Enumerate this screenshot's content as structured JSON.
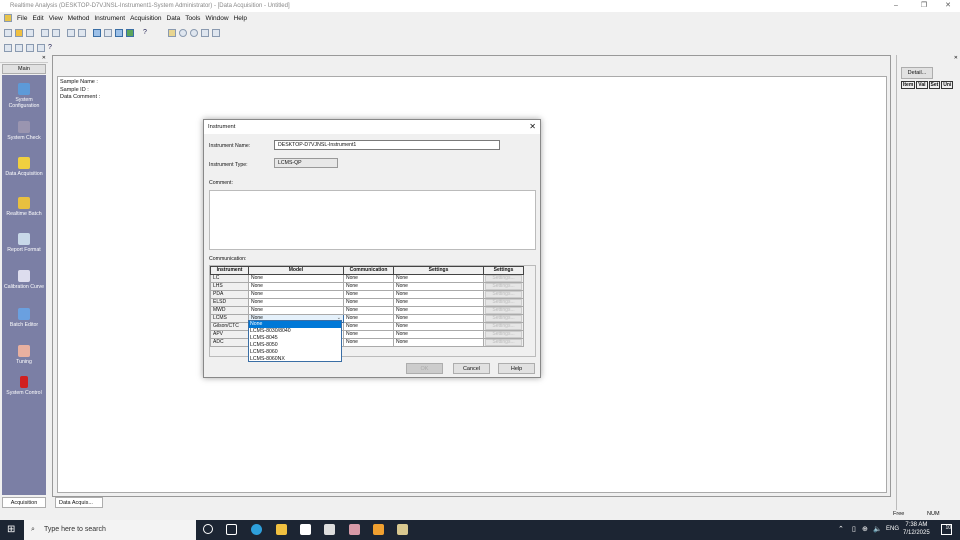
{
  "window": {
    "title": "Realtime Analysis (DESKTOP-D7VJNSL-Instrument1-System Administrator) - [Data Acquisition - Untitled]"
  },
  "menu": [
    "File",
    "Edit",
    "View",
    "Method",
    "Instrument",
    "Acquisition",
    "Data",
    "Tools",
    "Window",
    "Help"
  ],
  "leftpane": {
    "main_label": "Main",
    "bottom_tab": "Acquisition",
    "items": [
      {
        "label": "System Configuration",
        "icon": "system-configuration-icon"
      },
      {
        "label": "System Check",
        "icon": "system-check-icon"
      },
      {
        "label": "Data Acquisition",
        "icon": "data-acquisition-icon"
      },
      {
        "label": "Realtime Batch",
        "icon": "realtime-batch-icon"
      },
      {
        "label": "Report Format",
        "icon": "report-format-icon"
      },
      {
        "label": "Calibration Curve",
        "icon": "calibration-curve-icon"
      },
      {
        "label": "Batch Editor",
        "icon": "batch-editor-icon"
      },
      {
        "label": "Tuning",
        "icon": "tuning-icon"
      },
      {
        "label": "System Control",
        "icon": "system-control-icon"
      }
    ]
  },
  "main": {
    "sample_name": "Sample Name :",
    "sample_id": "Sample ID :",
    "data_comment": "Data Comment :",
    "tab": "Data Acquis..."
  },
  "rightpane": {
    "detail_button": "Detail...",
    "columns": [
      "Item",
      "Val",
      "Set",
      "Uni"
    ]
  },
  "status": {
    "free": "Free",
    "num": "NUM"
  },
  "dialog": {
    "title": "Instrument",
    "name_label": "Instrument Name:",
    "name_value": "DESKTOP-D7VJNSL-Instrument1",
    "type_label": "Instrument Type:",
    "type_value": "LCMS-QP",
    "comment_label": "Comment:",
    "comment_value": "",
    "communication_label": "Communication:",
    "columns": [
      "Instrument",
      "Model",
      "Communication",
      "Settings",
      "Settings"
    ],
    "rows": [
      {
        "instrument": "LC",
        "model": "None",
        "comm": "None",
        "settings": "None",
        "button": "Settings..."
      },
      {
        "instrument": "LHS",
        "model": "None",
        "comm": "None",
        "settings": "None",
        "button": "Settings..."
      },
      {
        "instrument": "PDA",
        "model": "None",
        "comm": "None",
        "settings": "None",
        "button": "Settings..."
      },
      {
        "instrument": "ELSD",
        "model": "None",
        "comm": "None",
        "settings": "None",
        "button": "Settings..."
      },
      {
        "instrument": "MWD",
        "model": "None",
        "comm": "None",
        "settings": "None",
        "button": "Settings..."
      },
      {
        "instrument": "LCMS",
        "model": "None",
        "comm": "None",
        "settings": "None",
        "button": "Settings..."
      },
      {
        "instrument": "Gilson/CTC",
        "model": "",
        "comm": "None",
        "settings": "None",
        "button": "Settings..."
      },
      {
        "instrument": "APV",
        "model": "",
        "comm": "None",
        "settings": "None",
        "button": "Settings..."
      },
      {
        "instrument": "ADC",
        "model": "",
        "comm": "None",
        "settings": "None",
        "button": "Settings..."
      }
    ],
    "dropdown_options": [
      "None",
      "LCMS-8030/8040",
      "LCMS-8045",
      "LCMS-8050",
      "LCMS-8060",
      "LCMS-8060NX"
    ],
    "dropdown_selected": "None",
    "ok": "OK",
    "cancel": "Cancel",
    "help": "Help"
  },
  "taskbar": {
    "search_placeholder": "Type here to search",
    "time": "7:38 AM",
    "date": "7/12/2025",
    "lang": "ENG",
    "notifications": "10"
  }
}
